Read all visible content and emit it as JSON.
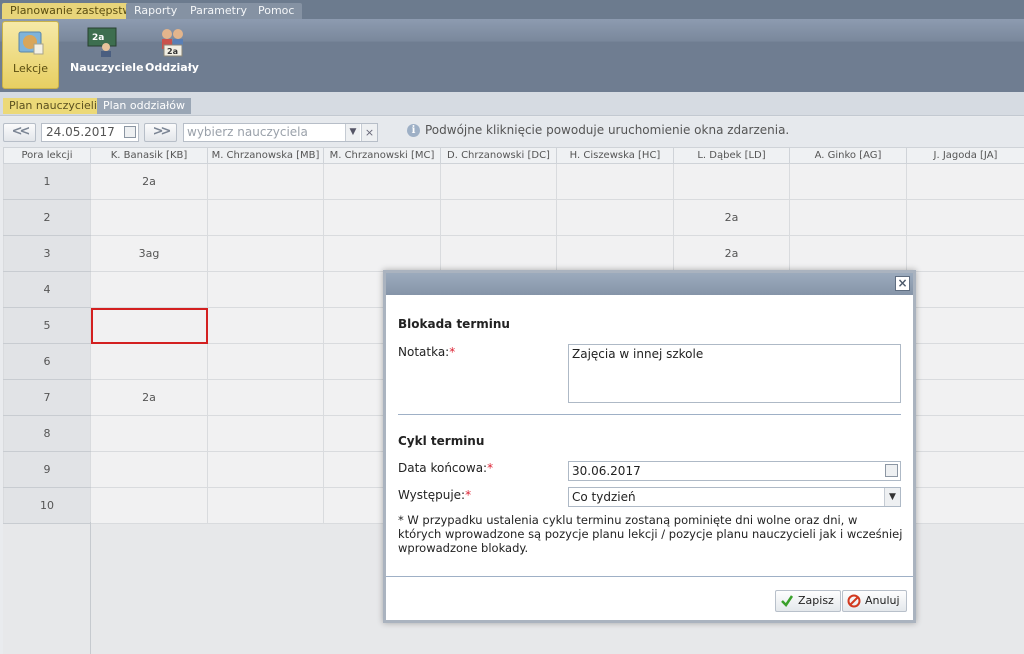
{
  "top_tabs": [
    "Planowanie zastępstw",
    "Raporty",
    "Parametry",
    "Pomoc"
  ],
  "ribbon": {
    "lessons": "Lekcje",
    "teachers": "Nauczyciele",
    "classes": "Oddziały"
  },
  "sub_tabs": [
    "Plan nauczycieli",
    "Plan oddziałów"
  ],
  "toolbar": {
    "prev": "<<",
    "next": ">>",
    "date": "24.05.2017",
    "teacher_placeholder": "wybierz nauczyciela",
    "info": "Podwójne kliknięcie powoduje uruchomienie okna zdarzenia."
  },
  "grid": {
    "headers": [
      "Pora lekcji",
      "K. Banasik [KB]",
      "M. Chrzanowska [MB]",
      "M. Chrzanowski [MC]",
      "D. Chrzanowski [DC]",
      "H. Ciszewska [HC]",
      "L. Dąbek [LD]",
      "A. Ginko [AG]",
      "J. Jagoda [JA]"
    ],
    "rows": [
      [
        "1",
        "2a",
        "",
        "",
        "",
        "",
        "",
        "",
        ""
      ],
      [
        "2",
        "",
        "",
        "",
        "",
        "",
        "2a",
        "",
        ""
      ],
      [
        "3",
        "3ag",
        "",
        "",
        "",
        "",
        "2a",
        "",
        ""
      ],
      [
        "4",
        "",
        "",
        "",
        "",
        "",
        "",
        "",
        ""
      ],
      [
        "5",
        "",
        "",
        "",
        "",
        "",
        "",
        "",
        ""
      ],
      [
        "6",
        "",
        "",
        "",
        "",
        "",
        "",
        "",
        ""
      ],
      [
        "7",
        "2a",
        "",
        "",
        "",
        "",
        "",
        "",
        ""
      ],
      [
        "8",
        "",
        "",
        "",
        "",
        "",
        "",
        "",
        ""
      ],
      [
        "9",
        "",
        "",
        "",
        "",
        "",
        "",
        "",
        ""
      ],
      [
        "10",
        "",
        "",
        "",
        "",
        "",
        "",
        "",
        ""
      ]
    ]
  },
  "modal": {
    "close": "×",
    "block_title": "Blokada terminu",
    "note_label": "Notatka:",
    "note_value": "Zajęcia w innej szkole",
    "cycle_title": "Cykl terminu",
    "end_date_label": "Data końcowa:",
    "end_date_value": "30.06.2017",
    "occurs_label": "Występuje:",
    "occurs_value": "Co tydzień",
    "required_mark": "*",
    "info_note": "* W przypadku ustalenia cyklu terminu zostaną pominięte dni wolne oraz dni, w których wprowadzone są pozycje planu lekcji / pozycje planu nauczycieli jak i wcześniej wprowadzone blokady.",
    "save": "Zapisz",
    "cancel": "Anuluj"
  }
}
